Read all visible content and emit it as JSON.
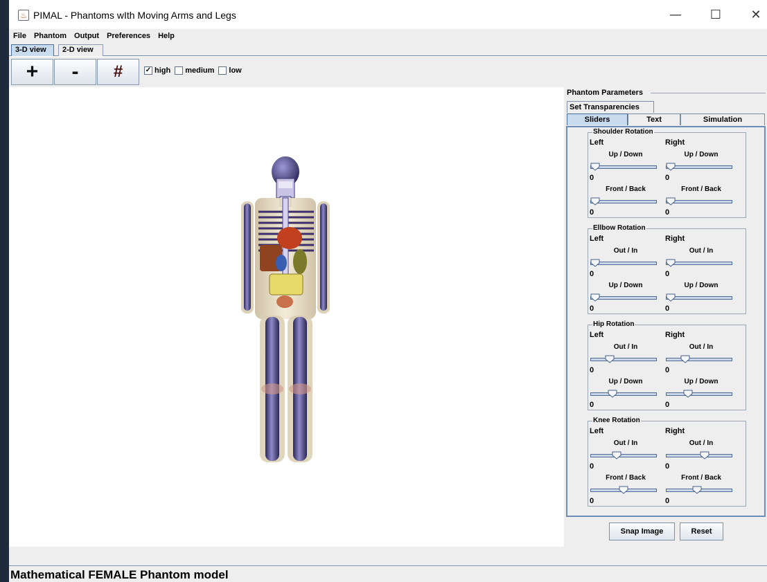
{
  "window": {
    "title": "PIMAL - Phantoms wIth Moving Arms and Legs",
    "minimize_glyph": "—",
    "maximize_glyph": "☐",
    "close_glyph": "✕",
    "app_icon": "java-coffee-icon"
  },
  "menu": {
    "items": [
      "File",
      "Phantom",
      "Output",
      "Preferences",
      "Help"
    ]
  },
  "view_tabs": {
    "tab_3d": "3-D view",
    "tab_2d": "2-D view",
    "active": "3-D view"
  },
  "toolbar": {
    "zoom_in_glyph": "+",
    "zoom_out_glyph": "-",
    "grid_glyph": "#",
    "quality": {
      "high": {
        "label": "high",
        "checked": true
      },
      "medium": {
        "label": "medium",
        "checked": false
      },
      "low": {
        "label": "low",
        "checked": false
      }
    }
  },
  "panel": {
    "title": "Phantom Parameters",
    "tabs": {
      "set_transparencies": "Set Transparencies",
      "sliders": "Sliders",
      "text": "Text",
      "simulation": "Simulation",
      "active": "Sliders"
    },
    "left_label": "Left",
    "right_label": "Right",
    "groups": [
      {
        "title": "Shoulder Rotation",
        "rows": [
          {
            "label": "Up / Down",
            "left_value": "0",
            "right_value": "0",
            "left_fraction": 0.0,
            "right_fraction": 0.0
          },
          {
            "label": "Front / Back",
            "left_value": "0",
            "right_value": "0",
            "left_fraction": 0.0,
            "right_fraction": 0.0
          }
        ]
      },
      {
        "title": "Ellbow Rotation",
        "rows": [
          {
            "label": "Out / In",
            "left_value": "0",
            "right_value": "0",
            "left_fraction": 0.0,
            "right_fraction": 0.0
          },
          {
            "label": "Up / Down",
            "left_value": "0",
            "right_value": "0",
            "left_fraction": 0.0,
            "right_fraction": 0.0
          }
        ]
      },
      {
        "title": "Hip Rotation",
        "rows": [
          {
            "label": "Out / In",
            "left_value": "0",
            "right_value": "0",
            "left_fraction": 0.25,
            "right_fraction": 0.25
          },
          {
            "label": "Up / Down",
            "left_value": "0",
            "right_value": "0",
            "left_fraction": 0.3,
            "right_fraction": 0.3
          }
        ]
      },
      {
        "title": "Knee Rotation",
        "rows": [
          {
            "label": "Out / In",
            "left_value": "0",
            "right_value": "0",
            "left_fraction": 0.38,
            "right_fraction": 0.6
          },
          {
            "label": "Front / Back",
            "left_value": "0",
            "right_value": "0",
            "left_fraction": 0.5,
            "right_fraction": 0.46
          }
        ]
      }
    ],
    "snap_button": "Snap Image",
    "reset_button": "Reset"
  },
  "status": {
    "model_text": "Mathematical FEMALE Phantom model"
  }
}
